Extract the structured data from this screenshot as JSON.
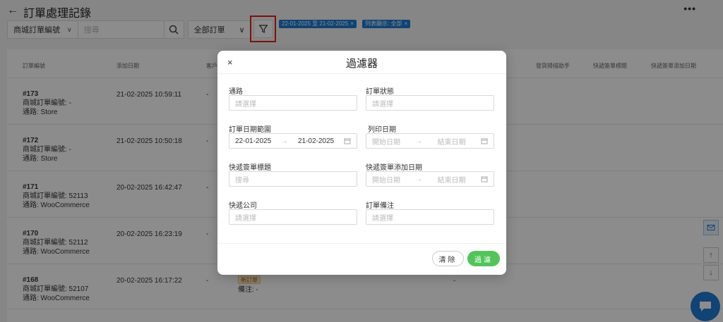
{
  "header": {
    "title": "訂單處理記錄",
    "back_icon": "back-arrow-icon",
    "more_icon": "more-icon"
  },
  "toolbar": {
    "field_select": "商城訂單編號",
    "search_placeholder": "搜尋",
    "status_select": "全部訂單",
    "tags": [
      "22-01-2025 至 21-02-2025",
      "列表顯示: 全部"
    ],
    "tag_close": "×",
    "chevron": "∨"
  },
  "table": {
    "headers": [
      "訂單編號",
      "添加日期",
      "客戶",
      "發貨掃描助手",
      "快遞簽單標題",
      "快遞簽單添加日期"
    ],
    "rows": [
      {
        "id": "#173",
        "line2": "商城訂單編號: -",
        "line3": "通路: Store",
        "date": "21-02-2025 10:59:11",
        "customer": "-"
      },
      {
        "id": "#172",
        "line2": "商城訂單編號: -",
        "line3": "通路: Store",
        "date": "21-02-2025 10:50:18",
        "customer": "-"
      },
      {
        "id": "#171",
        "line2": "商城訂單編號: 52113",
        "line3": "通路: WooCommerce",
        "date": "20-02-2025 16:42:47",
        "customer": "-"
      },
      {
        "id": "#170",
        "line2": "商城訂單編號: 52112",
        "line3": "通路: WooCommerce",
        "date": "20-02-2025 16:23:19",
        "customer": "-"
      },
      {
        "id": "#168",
        "line2": "商城訂單編號: 52107",
        "line3": "通路: WooCommerce",
        "date": "20-02-2025 16:17:22",
        "customer": "-",
        "status_tag": "新訂單",
        "note": "備注: -",
        "extra": "-"
      }
    ]
  },
  "modal": {
    "title": "過濾器",
    "close": "×",
    "fields": {
      "channel_label": "通路",
      "channel_placeholder": "請選擇",
      "order_status_label": "訂單狀態",
      "order_status_placeholder": "請選擇",
      "order_date_label": "訂單日期範圍",
      "order_date_start": "22-01-2025",
      "order_date_end": "21-02-2025",
      "print_date_label": "列印日期",
      "print_date_start": "開始日期",
      "print_date_end": "結束日期",
      "courier_title_label": "快遞簽單標題",
      "courier_title_placeholder": "搜尋",
      "courier_date_label": "快遞簽單添加日期",
      "courier_date_start": "開始日期",
      "courier_date_end": "結束日期",
      "courier_company_label": "快遞公司",
      "courier_company_placeholder": "請選擇",
      "order_note_label": "訂單備注",
      "order_note_placeholder": "請選擇"
    },
    "range_arrow": "→",
    "clear_button": "清除",
    "apply_button": "過濾"
  },
  "colors": {
    "accent": "#1f7bd4",
    "apply_green": "#52c45a",
    "highlight_red": "#e02020"
  }
}
